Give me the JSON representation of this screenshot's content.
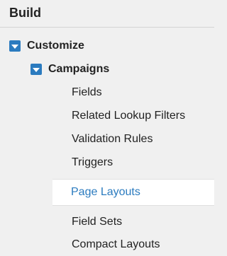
{
  "section": {
    "title": "Build"
  },
  "tree": {
    "customize": {
      "label": "Customize",
      "icon": "expanded-toggle-icon"
    },
    "campaigns": {
      "label": "Campaigns",
      "icon": "expanded-toggle-icon"
    },
    "items": [
      {
        "label": "Fields"
      },
      {
        "label": "Related Lookup Filters"
      },
      {
        "label": "Validation Rules"
      },
      {
        "label": "Triggers"
      },
      {
        "label": "Page Layouts",
        "selected": true
      },
      {
        "label": "Field Sets"
      },
      {
        "label": "Compact Layouts"
      }
    ]
  },
  "colors": {
    "accent": "#2b7bbf",
    "background": "#f0f0f0",
    "selected_background": "#ffffff",
    "text": "#222222"
  }
}
